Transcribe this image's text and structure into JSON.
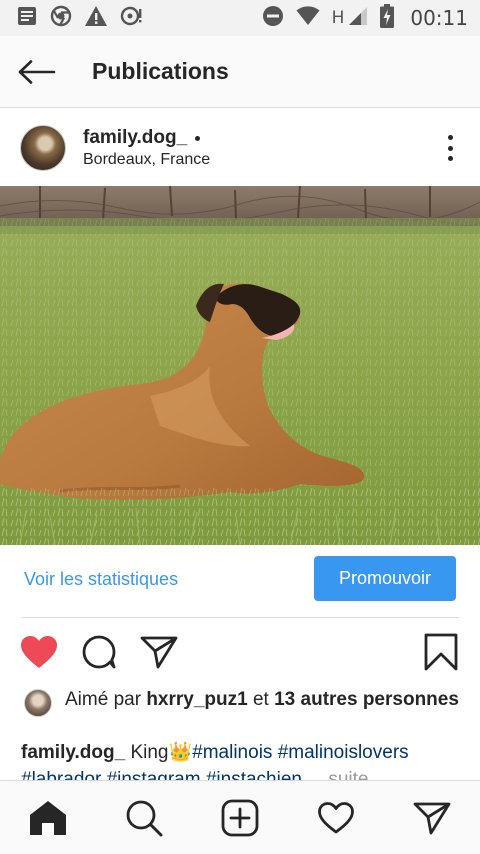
{
  "status_bar": {
    "time": "00:11",
    "network_type": "H",
    "icons": [
      "message-notification-icon",
      "chrome-icon",
      "warning-icon",
      "usb-debug-icon",
      "do-not-disturb-icon",
      "wifi-icon",
      "cell-signal-icon",
      "battery-charging-icon"
    ]
  },
  "header": {
    "title": "Publications"
  },
  "post": {
    "username": "family.dog_",
    "location": "Bordeaux, France",
    "photo_subject": "dog-lying-in-grass-photo"
  },
  "insights": {
    "stats_label": "Voir les statistiques",
    "promote_label": "Promouvoir"
  },
  "actions": {
    "liked": true,
    "like_color": "#ed4956"
  },
  "likes": {
    "prefix": "Aimé par",
    "liker": "hxrry_puz1",
    "joiner": "et",
    "others": "13 autres personnes"
  },
  "caption": {
    "username": "family.dog_",
    "text": "King",
    "emoji": "👑",
    "tags": [
      "#malinois",
      "#malinoislovers",
      "#labrador",
      "#instagram",
      "#instachien"
    ],
    "more": "... suite"
  },
  "colors": {
    "accent": "#3897f0",
    "hashtag": "#003569",
    "like": "#ed4956"
  }
}
